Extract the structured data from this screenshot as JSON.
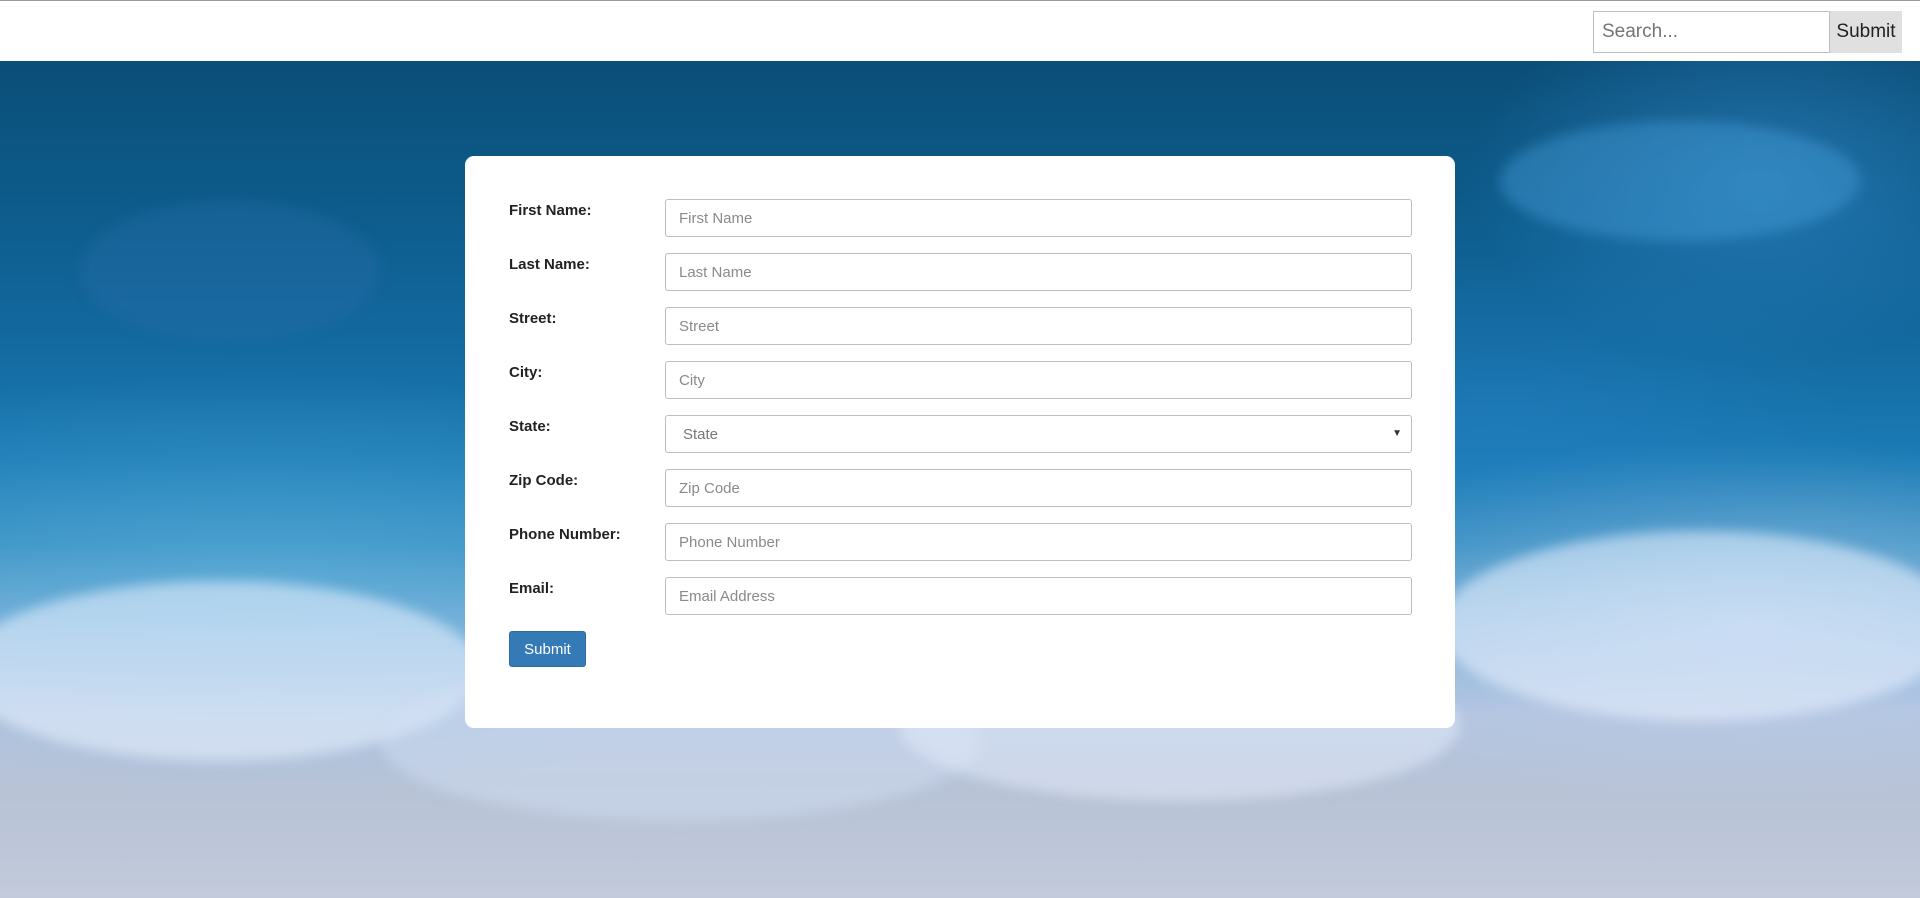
{
  "search": {
    "placeholder": "Search...",
    "button_label": "Submit"
  },
  "form": {
    "fields": [
      {
        "label": "First Name:",
        "placeholder": "First Name"
      },
      {
        "label": "Last Name:",
        "placeholder": "Last Name"
      },
      {
        "label": "Street:",
        "placeholder": "Street"
      },
      {
        "label": "City:",
        "placeholder": "City"
      },
      {
        "label": "State:",
        "placeholder": "State"
      },
      {
        "label": "Zip Code:",
        "placeholder": "Zip Code"
      },
      {
        "label": "Phone Number:",
        "placeholder": "Phone Number"
      },
      {
        "label": "Email:",
        "placeholder": "Email Address"
      }
    ],
    "submit_label": "Submit"
  },
  "colors": {
    "primary_button": "#337ab7",
    "card_background": "#ffffff",
    "ocean_background": "#1c7cb6"
  }
}
